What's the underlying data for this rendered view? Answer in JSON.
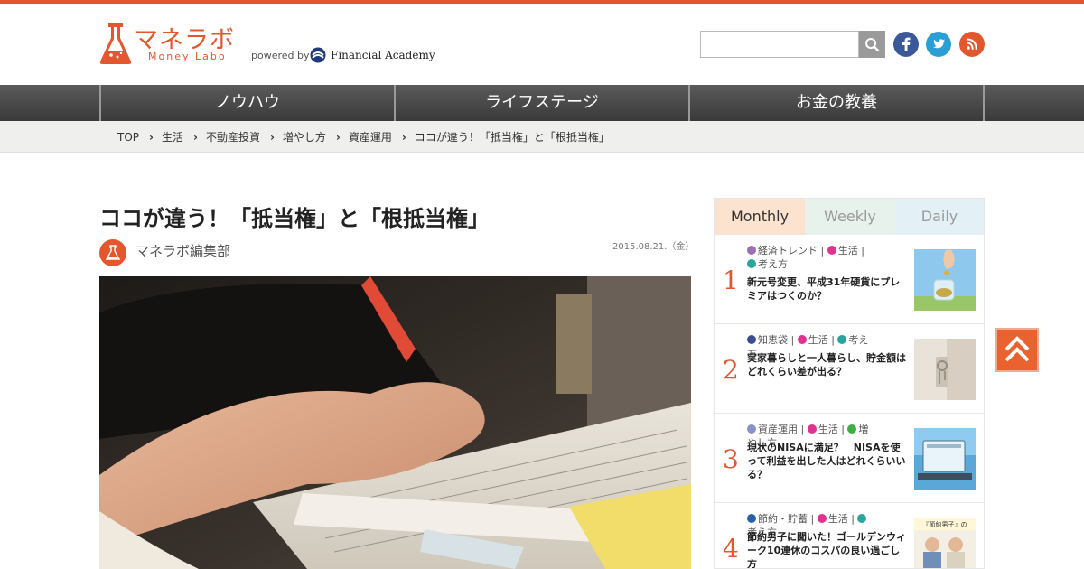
{
  "header": {
    "logo_jp": "マネラボ",
    "logo_en": "Money Labo",
    "powered_by": "powered by",
    "partner_name": "Financial Academy",
    "search": {
      "value": "",
      "placeholder": ""
    },
    "social": [
      "facebook-icon",
      "twitter-icon",
      "rss-icon"
    ]
  },
  "nav": {
    "items": [
      "ノウハウ",
      "ライフステージ",
      "お金の教養"
    ]
  },
  "breadcrumb": [
    "TOP",
    "生活",
    "不動産投資",
    "増やし方",
    "資産運用",
    "ココが違う！「抵当権」と「根抵当権」"
  ],
  "article": {
    "title": "ココが違う！「抵当権」と「根抵当権」",
    "author": "マネラボ編集部",
    "date": "2015.08.21.（金）"
  },
  "ranking": {
    "tabs": [
      "Monthly",
      "Weekly",
      "Daily"
    ],
    "active_tab": "Monthly",
    "items": [
      {
        "rank": "1",
        "tags": [
          {
            "label": "経済トレンド",
            "color": "#9b6fb3"
          },
          {
            "label": "生活",
            "color": "#e0338f"
          },
          {
            "label": "考え方",
            "color": "#2aa59c"
          }
        ],
        "title": "新元号変更、平成31年硬貨にプレミアはつくのか？"
      },
      {
        "rank": "2",
        "tags": [
          {
            "label": "知恵袋",
            "color": "#3a4d8f"
          },
          {
            "label": "生活",
            "color": "#e0338f"
          },
          {
            "label": "考え方",
            "color": "#2aa59c"
          }
        ],
        "title": "実家暮らしと一人暮らし、貯金額はどれくらい差が出る？"
      },
      {
        "rank": "3",
        "tags": [
          {
            "label": "資産運用",
            "color": "#8a93c8"
          },
          {
            "label": "生活",
            "color": "#e0338f"
          },
          {
            "label": "増やし方",
            "color": "#3fae49"
          }
        ],
        "title": "現状のNISAに満足？　NISAを使って利益を出した人はどれくらいいる？"
      },
      {
        "rank": "4",
        "tags": [
          {
            "label": "節約・貯蓄",
            "color": "#2a5fa8"
          },
          {
            "label": "生活",
            "color": "#e0338f"
          },
          {
            "label": "考え方",
            "color": "#2aa59c"
          }
        ],
        "title": "節約男子に聞いた！ゴールデンウィーク10連休のコスパの良い過ごし方"
      }
    ],
    "thumb4_caption": "『節約男子』の"
  },
  "colors": {
    "accent": "#e2572d",
    "nav": "#4a4a4a",
    "breadcrumb_bg": "#efefee"
  }
}
